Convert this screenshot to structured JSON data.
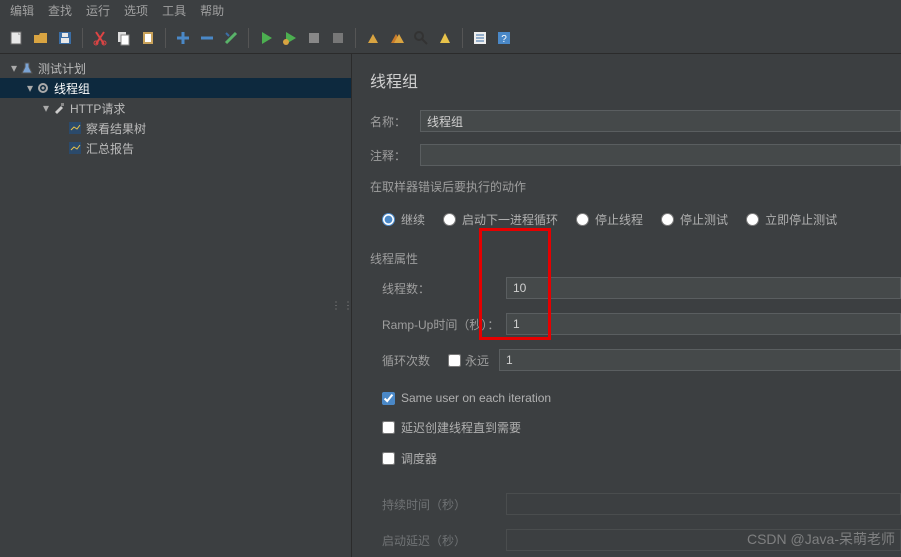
{
  "menubar": [
    "编辑",
    "查找",
    "运行",
    "选项",
    "工具",
    "帮助"
  ],
  "tree": {
    "root": "测试计划",
    "selected": "线程组",
    "http": "HTTP请求",
    "result_tree": "察看结果树",
    "summary": "汇总报告"
  },
  "main": {
    "title": "线程组",
    "name_label": "名称：",
    "name_value": "线程组",
    "comment_label": "注释：",
    "comment_value": "",
    "on_error_title": "在取样器错误后要执行的动作",
    "radios": {
      "cont": "继续",
      "next_loop": "启动下一进程循环",
      "stop_thread": "停止线程",
      "stop_test": "停止测试",
      "stop_test_now": "立即停止测试"
    },
    "thread_props_title": "线程属性",
    "threads_label": "线程数：",
    "threads_value": "10",
    "rampup_label": "Ramp-Up时间（秒）：",
    "rampup_value": "1",
    "loop_label": "循环次数",
    "loop_forever": "永远",
    "loop_value": "1",
    "same_user": "Same user on each iteration",
    "delay_create": "延迟创建线程直到需要",
    "scheduler": "调度器",
    "duration_label": "持续时间（秒）",
    "startup_delay_label": "启动延迟（秒）"
  },
  "watermark": "CSDN @Java-呆萌老师"
}
